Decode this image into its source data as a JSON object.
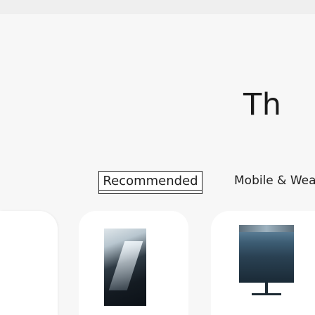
{
  "heading": {
    "text": "Th"
  },
  "tabs": [
    {
      "label": "Recommended",
      "selected": true
    },
    {
      "label": "Mobile & Wear",
      "selected": false
    }
  ],
  "products": [
    {
      "image": "phone-product-image"
    },
    {
      "image": "monitor-product-image"
    }
  ]
}
